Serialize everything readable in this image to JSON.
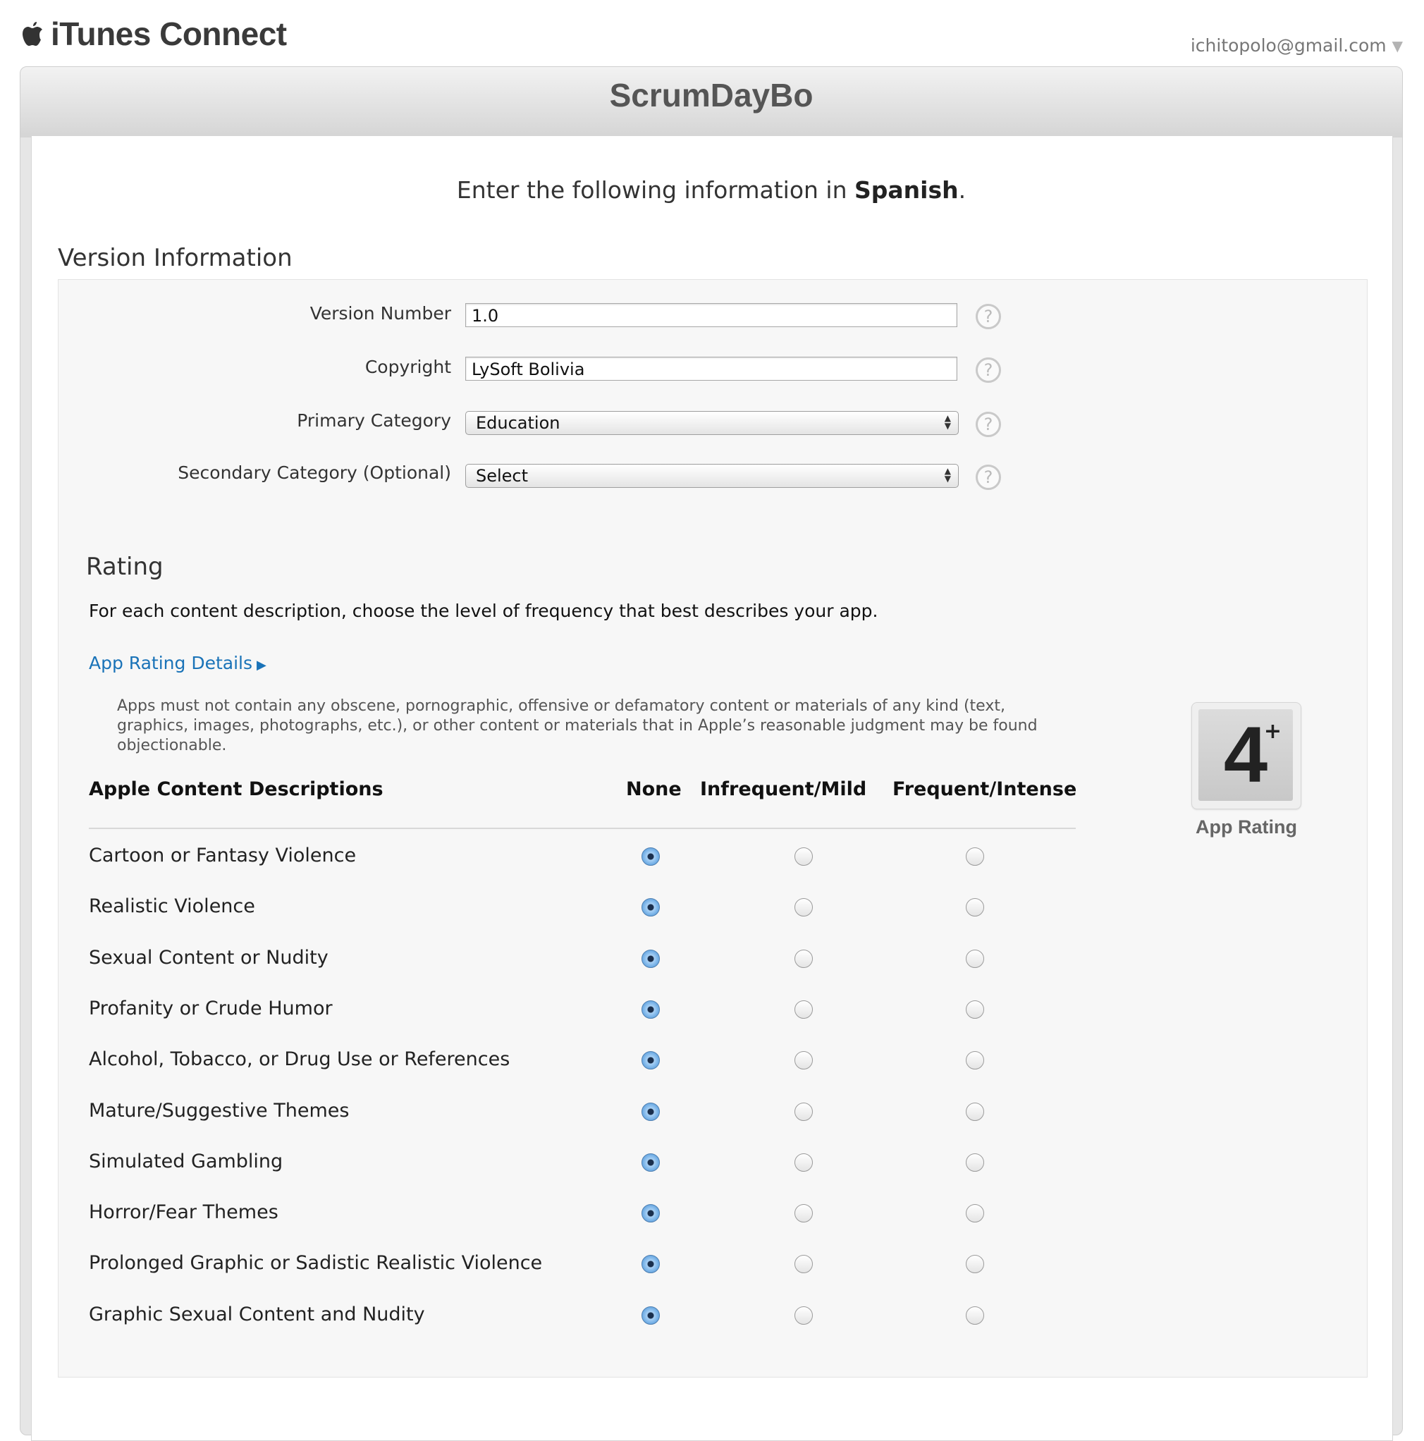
{
  "header": {
    "brand": "iTunes Connect",
    "account_email": "ichitopolo@gmail.com",
    "account_caret": "▼"
  },
  "app": {
    "title": "ScrumDayBo"
  },
  "instruction": {
    "prefix": "Enter the following information in ",
    "language": "Spanish",
    "suffix": "."
  },
  "version_info": {
    "heading": "Version Information",
    "version_number": {
      "label": "Version Number",
      "value": "1.0"
    },
    "copyright": {
      "label": "Copyright",
      "value": "LySoft Bolivia"
    },
    "primary_category": {
      "label": "Primary Category",
      "value": "Education"
    },
    "secondary_category": {
      "label": "Secondary Category (Optional)",
      "value": "Select"
    },
    "help_glyph": "?"
  },
  "rating": {
    "heading": "Rating",
    "description": "For each content description, choose the level of frequency that best describes your app.",
    "details_link": "App Rating Details",
    "details_arrow": "▶",
    "policy": "Apps must not contain any obscene, pornographic, offensive or defamatory content or materials of any kind (text, graphics, images, photographs, etc.), or other content or materials that in Apple’s reasonable judgment may be found objectionable.",
    "columns": {
      "descriptions": "Apple Content Descriptions",
      "none": "None",
      "mild": "Infrequent/Mild",
      "intense": "Frequent/Intense"
    },
    "rows": [
      {
        "label": "Cartoon or Fantasy Violence",
        "selected": "none"
      },
      {
        "label": "Realistic Violence",
        "selected": "none"
      },
      {
        "label": "Sexual Content or Nudity",
        "selected": "none"
      },
      {
        "label": "Profanity or Crude Humor",
        "selected": "none"
      },
      {
        "label": "Alcohol, Tobacco, or Drug Use or References",
        "selected": "none"
      },
      {
        "label": "Mature/Suggestive Themes",
        "selected": "none"
      },
      {
        "label": "Simulated Gambling",
        "selected": "none"
      },
      {
        "label": "Horror/Fear Themes",
        "selected": "none"
      },
      {
        "label": "Prolonged Graphic or Sadistic Realistic Violence",
        "selected": "none"
      },
      {
        "label": "Graphic Sexual Content and Nudity",
        "selected": "none"
      }
    ],
    "badge": {
      "number": "4",
      "plus": "+",
      "caption": "App Rating"
    }
  }
}
